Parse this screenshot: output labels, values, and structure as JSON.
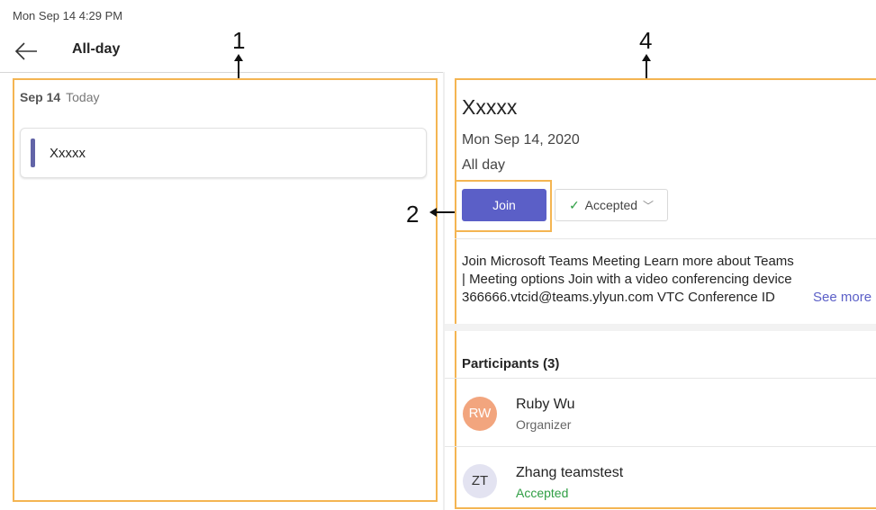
{
  "status_bar": {
    "datetime": "Mon Sep 14  4:29 PM"
  },
  "header": {
    "back_icon": "arrow-left-icon",
    "title": "All-day"
  },
  "list": {
    "date": "Sep 14",
    "date_label": "Today",
    "events": [
      {
        "title": "Xxxxx",
        "accent": "#6264a7"
      }
    ]
  },
  "detail": {
    "title": "Xxxxx",
    "date": "Mon Sep 14, 2020",
    "time": "All day",
    "join_label": "Join",
    "rsvp_label": "Accepted",
    "description_lines": [
      "Join Microsoft Teams Meeting Learn more about Teams",
      "| Meeting options Join with a video conferencing device",
      "366666.vtcid@teams.ylyun.com VTC Conference ID"
    ],
    "see_more": "See more",
    "participants_heading": "Participants (3)",
    "participants": [
      {
        "initials": "RW",
        "name": "Ruby Wu",
        "role": "Organizer",
        "avatar_bg": "#f2a57e",
        "avatar_fg": "#ffffff",
        "role_color": "#666666"
      },
      {
        "initials": "ZT",
        "name": "Zhang teamstest",
        "role": "Accepted",
        "avatar_bg": "#e3e3f1",
        "avatar_fg": "#333333",
        "role_color": "#2f9e44"
      }
    ]
  },
  "callouts": {
    "c1": "1",
    "c2": "2",
    "c4": "4"
  },
  "colors": {
    "accent": "#5b5fc7",
    "callout_border": "#f4b552"
  }
}
